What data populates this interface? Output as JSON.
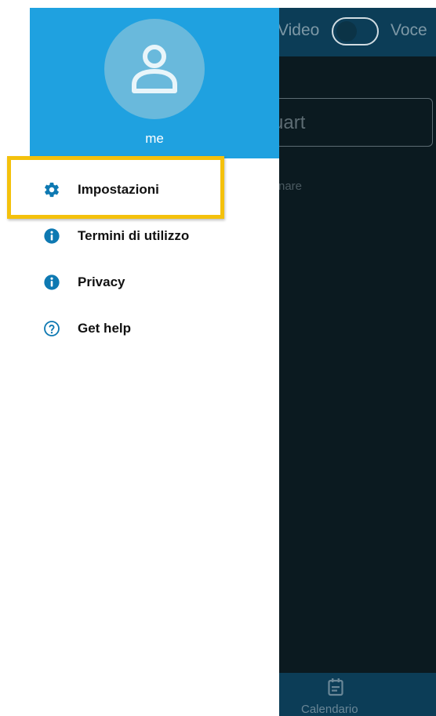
{
  "app": {
    "toggle_left_label": "Video",
    "toggle_right_label": "Voce",
    "input_partial_text": "uart",
    "subtext_partial": "rnare",
    "bottom_tab_label": "Calendario"
  },
  "drawer": {
    "user_name": "me",
    "items": [
      {
        "label": "Impostazioni",
        "icon": "gear-icon"
      },
      {
        "label": "Termini di utilizzo",
        "icon": "info-icon"
      },
      {
        "label": "Privacy",
        "icon": "info-icon"
      },
      {
        "label": "Get help",
        "icon": "help-circle-icon"
      }
    ]
  },
  "colors": {
    "header_blue": "#1fa1e0",
    "icon_blue": "#0e79b2",
    "highlight": "#f4c10c",
    "app_bar": "#0c3d57",
    "app_body": "#0b1a20"
  }
}
